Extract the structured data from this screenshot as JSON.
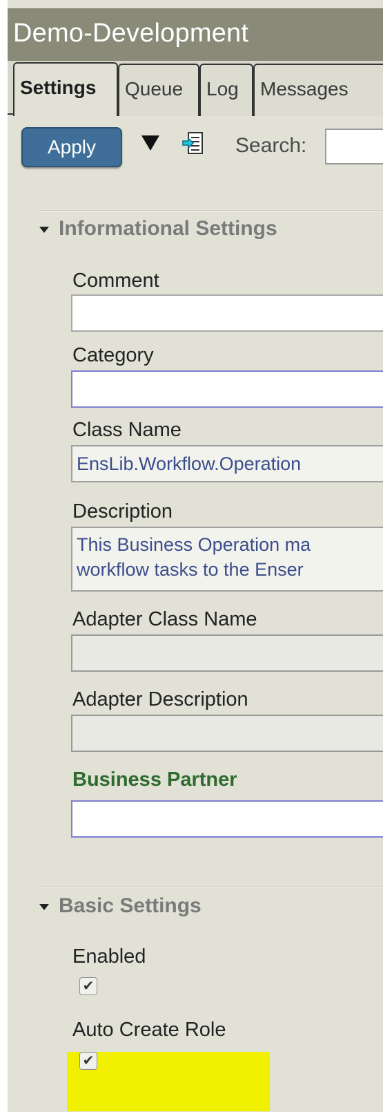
{
  "window": {
    "title": "Demo-Development"
  },
  "tabs": [
    {
      "label": "Settings",
      "active": true
    },
    {
      "label": "Queue",
      "active": false
    },
    {
      "label": "Log",
      "active": false
    },
    {
      "label": "Messages",
      "active": false
    }
  ],
  "toolbar": {
    "apply_label": "Apply",
    "search_label": "Search:",
    "search_value": ""
  },
  "informational_settings": {
    "header": "Informational Settings",
    "fields": {
      "comment": {
        "label": "Comment",
        "value": ""
      },
      "category": {
        "label": "Category",
        "value": ""
      },
      "class_name": {
        "label": "Class Name",
        "value": "EnsLib.Workflow.Operation"
      },
      "description": {
        "label": "Description",
        "value": "This Business Operation ma\nworkflow tasks to the Enser"
      },
      "adapter_class_name": {
        "label": "Adapter Class Name",
        "value": ""
      },
      "adapter_description": {
        "label": "Adapter Description",
        "value": ""
      },
      "business_partner": {
        "label": "Business Partner",
        "value": ""
      }
    }
  },
  "basic_settings": {
    "header": "Basic Settings",
    "enabled": {
      "label": "Enabled",
      "checked": true
    },
    "auto_create_role": {
      "label": "Auto Create Role",
      "checked": true,
      "highlight_color": "#f0f000"
    }
  },
  "colors": {
    "title_bar": "#8a8a79",
    "panel_background": "#e1e1d5",
    "apply_button": "#3f6f99",
    "business_partner_label": "#2e6b2e",
    "highlight": "#f0f000"
  },
  "icons": {
    "dropdown": "triangle-down-icon",
    "export": "export-document-icon",
    "section_collapse": "caret-down-icon",
    "checkmark": "✔"
  }
}
